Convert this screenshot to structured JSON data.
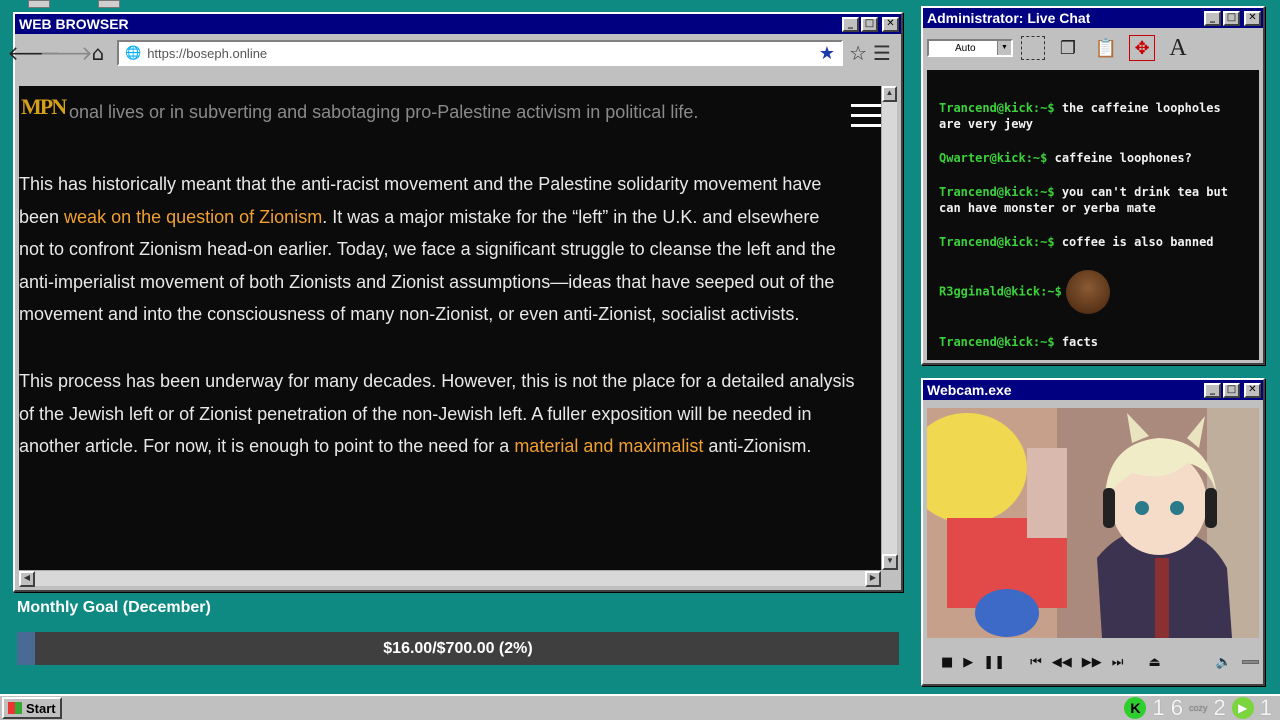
{
  "browser": {
    "title": "WEB BROWSER",
    "url": "https://boseph.online",
    "nav": {
      "back": "back-arrow",
      "forward": "forward-arrow",
      "home": "home-icon"
    },
    "page": {
      "logo_text": "MPN",
      "header_faded": "onal lives or in subverting and sabotaging pro-Palestine activism in political life.",
      "para1": [
        {
          "pre": "This has historically meant that the anti-racist movement and the Palestine solidarity movement have",
          "link": "",
          "post": ""
        },
        {
          "pre": "been ",
          "link": "weak on the question of Zionism",
          "post": ". It was a major mistake for the “left” in the U.K. and elsewhere"
        },
        {
          "pre": "not to confront Zionism head-on earlier. Today, we face a significant struggle to cleanse the left and the",
          "link": "",
          "post": ""
        },
        {
          "pre": "anti-imperialist movement of both Zionists and Zionist assumptions—ideas that have seeped out of the",
          "link": "",
          "post": ""
        },
        {
          "pre": "movement and into the consciousness of many non-Zionist, or even anti-Zionist, socialist activists.",
          "link": "",
          "post": ""
        }
      ],
      "para2": [
        {
          "pre": "This process has been underway for many decades. However, this is not the place for a detailed analysis",
          "link": "",
          "post": ""
        },
        {
          "pre": "of the Jewish left or of Zionist penetration of the non-Jewish left. A fuller exposition will be needed in",
          "link": "",
          "post": ""
        },
        {
          "pre": "another article. For now, it is enough to point to the need for a ",
          "link": "material and maximalist",
          "post": " anti-Zionism."
        }
      ]
    }
  },
  "goal": {
    "title": "Monthly Goal (December)",
    "text": "$16.00/$700.00 (2%)",
    "progress_pct": 2
  },
  "chat": {
    "title": "Administrator: Live Chat",
    "auto_label": "Auto",
    "messages": [
      {
        "user": "Trancend@kick:~$",
        "text": " the caffeine loopholes are very jewy",
        "emote": false
      },
      {
        "user": "Qwarter@kick:~$",
        "text": " caffeine loophones?",
        "emote": false
      },
      {
        "user": "Trancend@kick:~$",
        "text": " you can't drink tea but can have monster or yerba mate",
        "emote": false
      },
      {
        "user": "Trancend@kick:~$",
        "text": " coffee is also banned",
        "emote": false
      },
      {
        "user": "R3gginald@kick:~$",
        "text": "",
        "emote": true
      },
      {
        "user": "Trancend@kick:~$",
        "text": " facts",
        "emote": false
      }
    ]
  },
  "webcam": {
    "title": "Webcam.exe"
  },
  "taskbar": {
    "start_label": "Start",
    "tray_num1": "1 6",
    "tray_cozy": "cozy",
    "tray_num2": "2",
    "tray_num3": "1"
  },
  "colors": {
    "desktop": "#0f8a82",
    "titlebar": "#000080",
    "link": "#f0a030",
    "chat_user": "#3ad13a"
  }
}
